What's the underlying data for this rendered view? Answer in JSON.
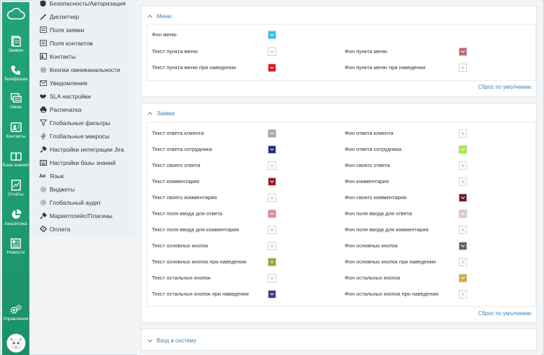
{
  "rail": [
    {
      "name": "cloud-logo-icon",
      "label": ""
    },
    {
      "name": "tickets-icon",
      "label": "Заявки"
    },
    {
      "name": "phone-icon",
      "label": "Телефония"
    },
    {
      "name": "omni-icon",
      "label": "Омни"
    },
    {
      "name": "contacts-icon",
      "label": "Контакты"
    },
    {
      "name": "knowledge-base-icon",
      "label": "База знаний"
    },
    {
      "name": "reports-icon",
      "label": "Отчёты"
    },
    {
      "name": "analytics-icon",
      "label": "Аналитика"
    },
    {
      "name": "news-icon",
      "label": "Новости"
    },
    {
      "name": "management-icon",
      "label": "Управление"
    }
  ],
  "menu": [
    {
      "icon": "shield-icon",
      "label": "Безопасность/Авторизация"
    },
    {
      "icon": "wand-icon",
      "label": "Диспетчер"
    },
    {
      "icon": "ticket-fields-icon",
      "label": "Поля заявки"
    },
    {
      "icon": "contact-fields-icon",
      "label": "Поля контактов"
    },
    {
      "icon": "contacts-book-icon",
      "label": "Контакты"
    },
    {
      "icon": "gear-icon",
      "label": "Кнопки омниканальности"
    },
    {
      "icon": "envelope-icon",
      "label": "Уведомления"
    },
    {
      "icon": "handshake-icon",
      "label": "SLA настройки"
    },
    {
      "icon": "printer-icon",
      "label": "Распечатка"
    },
    {
      "icon": "filter-icon",
      "label": "Глобальные фильтры"
    },
    {
      "icon": "lightning-icon",
      "label": "Глобальные макросы"
    },
    {
      "icon": "plug-icon",
      "label": "Настройки интеграции Jira"
    },
    {
      "icon": "keyboard-icon",
      "label": "Настройки базы знаний"
    },
    {
      "icon": "language-icon",
      "label": "Язык"
    },
    {
      "icon": "widgets-icon",
      "label": "Виджеты"
    },
    {
      "icon": "audit-icon",
      "label": "Глобальный аудит"
    },
    {
      "icon": "marketplace-icon",
      "label": "Маркетплейс/Плагины"
    },
    {
      "icon": "payment-icon",
      "label": "Оплата"
    }
  ],
  "sections": {
    "menu_section": {
      "title": "Меню",
      "rows_left": [
        {
          "label": "Фон меню",
          "color": "#29c7e8"
        },
        {
          "label": "Текст пункта меню",
          "color": ""
        },
        {
          "label": "Текст пункта меню при наведении",
          "color": "#e3101f"
        }
      ],
      "rows_right": [
        {
          "label": "Фон пункта меню",
          "color": "#c8646b"
        },
        {
          "label": "Фон пункта меню при наведении",
          "color": ""
        }
      ],
      "reset": "Сброс по умолчанию"
    },
    "tickets_section": {
      "title": "Заявки",
      "rows_left": [
        {
          "label": "Текст ответа клиента",
          "color": "#b0a5a7"
        },
        {
          "label": "Текст ответа сотрудника",
          "color": "#1e2a87"
        },
        {
          "label": "Текст своего ответа",
          "color": ""
        },
        {
          "label": "Текст комментария",
          "color": "#9c1620"
        },
        {
          "label": "Текст своего комментария",
          "color": ""
        },
        {
          "label": "Текст поля ввода для ответа",
          "color": "#e0898f"
        },
        {
          "label": "Текст поля ввода для комментария",
          "color": ""
        },
        {
          "label": "Текст основных кнопок",
          "color": ""
        },
        {
          "label": "Текст основных кнопок при наведении",
          "color": "#8eaa26"
        },
        {
          "label": "Текст остальных кнопок",
          "color": ""
        },
        {
          "label": "Текст остальных кнопок при наведении",
          "color": "#4f2a8c"
        }
      ],
      "rows_right": [
        {
          "label": "Фон ответа клиента",
          "color": ""
        },
        {
          "label": "Фон ответа сотрудника",
          "color": "#a6ee3f"
        },
        {
          "label": "Фон своего ответа",
          "color": ""
        },
        {
          "label": "Фон комментария",
          "color": ""
        },
        {
          "label": "Фон своего комментария",
          "color": "#6e1a1f"
        },
        {
          "label": "Фон поля ввода для ответа",
          "color": "#e8c9c9"
        },
        {
          "label": "Фон поля ввода для комментария",
          "color": ""
        },
        {
          "label": "Фон основных кнопок",
          "color": "#6b5a55"
        },
        {
          "label": "Фон основных кнопок при наведении",
          "color": ""
        },
        {
          "label": "Фон остальных кнопок",
          "color": "#d6ad2e"
        },
        {
          "label": "Фон остальных кнопок при наведении",
          "color": ""
        }
      ],
      "reset": "Сброс по умолчанию"
    },
    "login_section": {
      "title": "Вход в систему"
    }
  }
}
